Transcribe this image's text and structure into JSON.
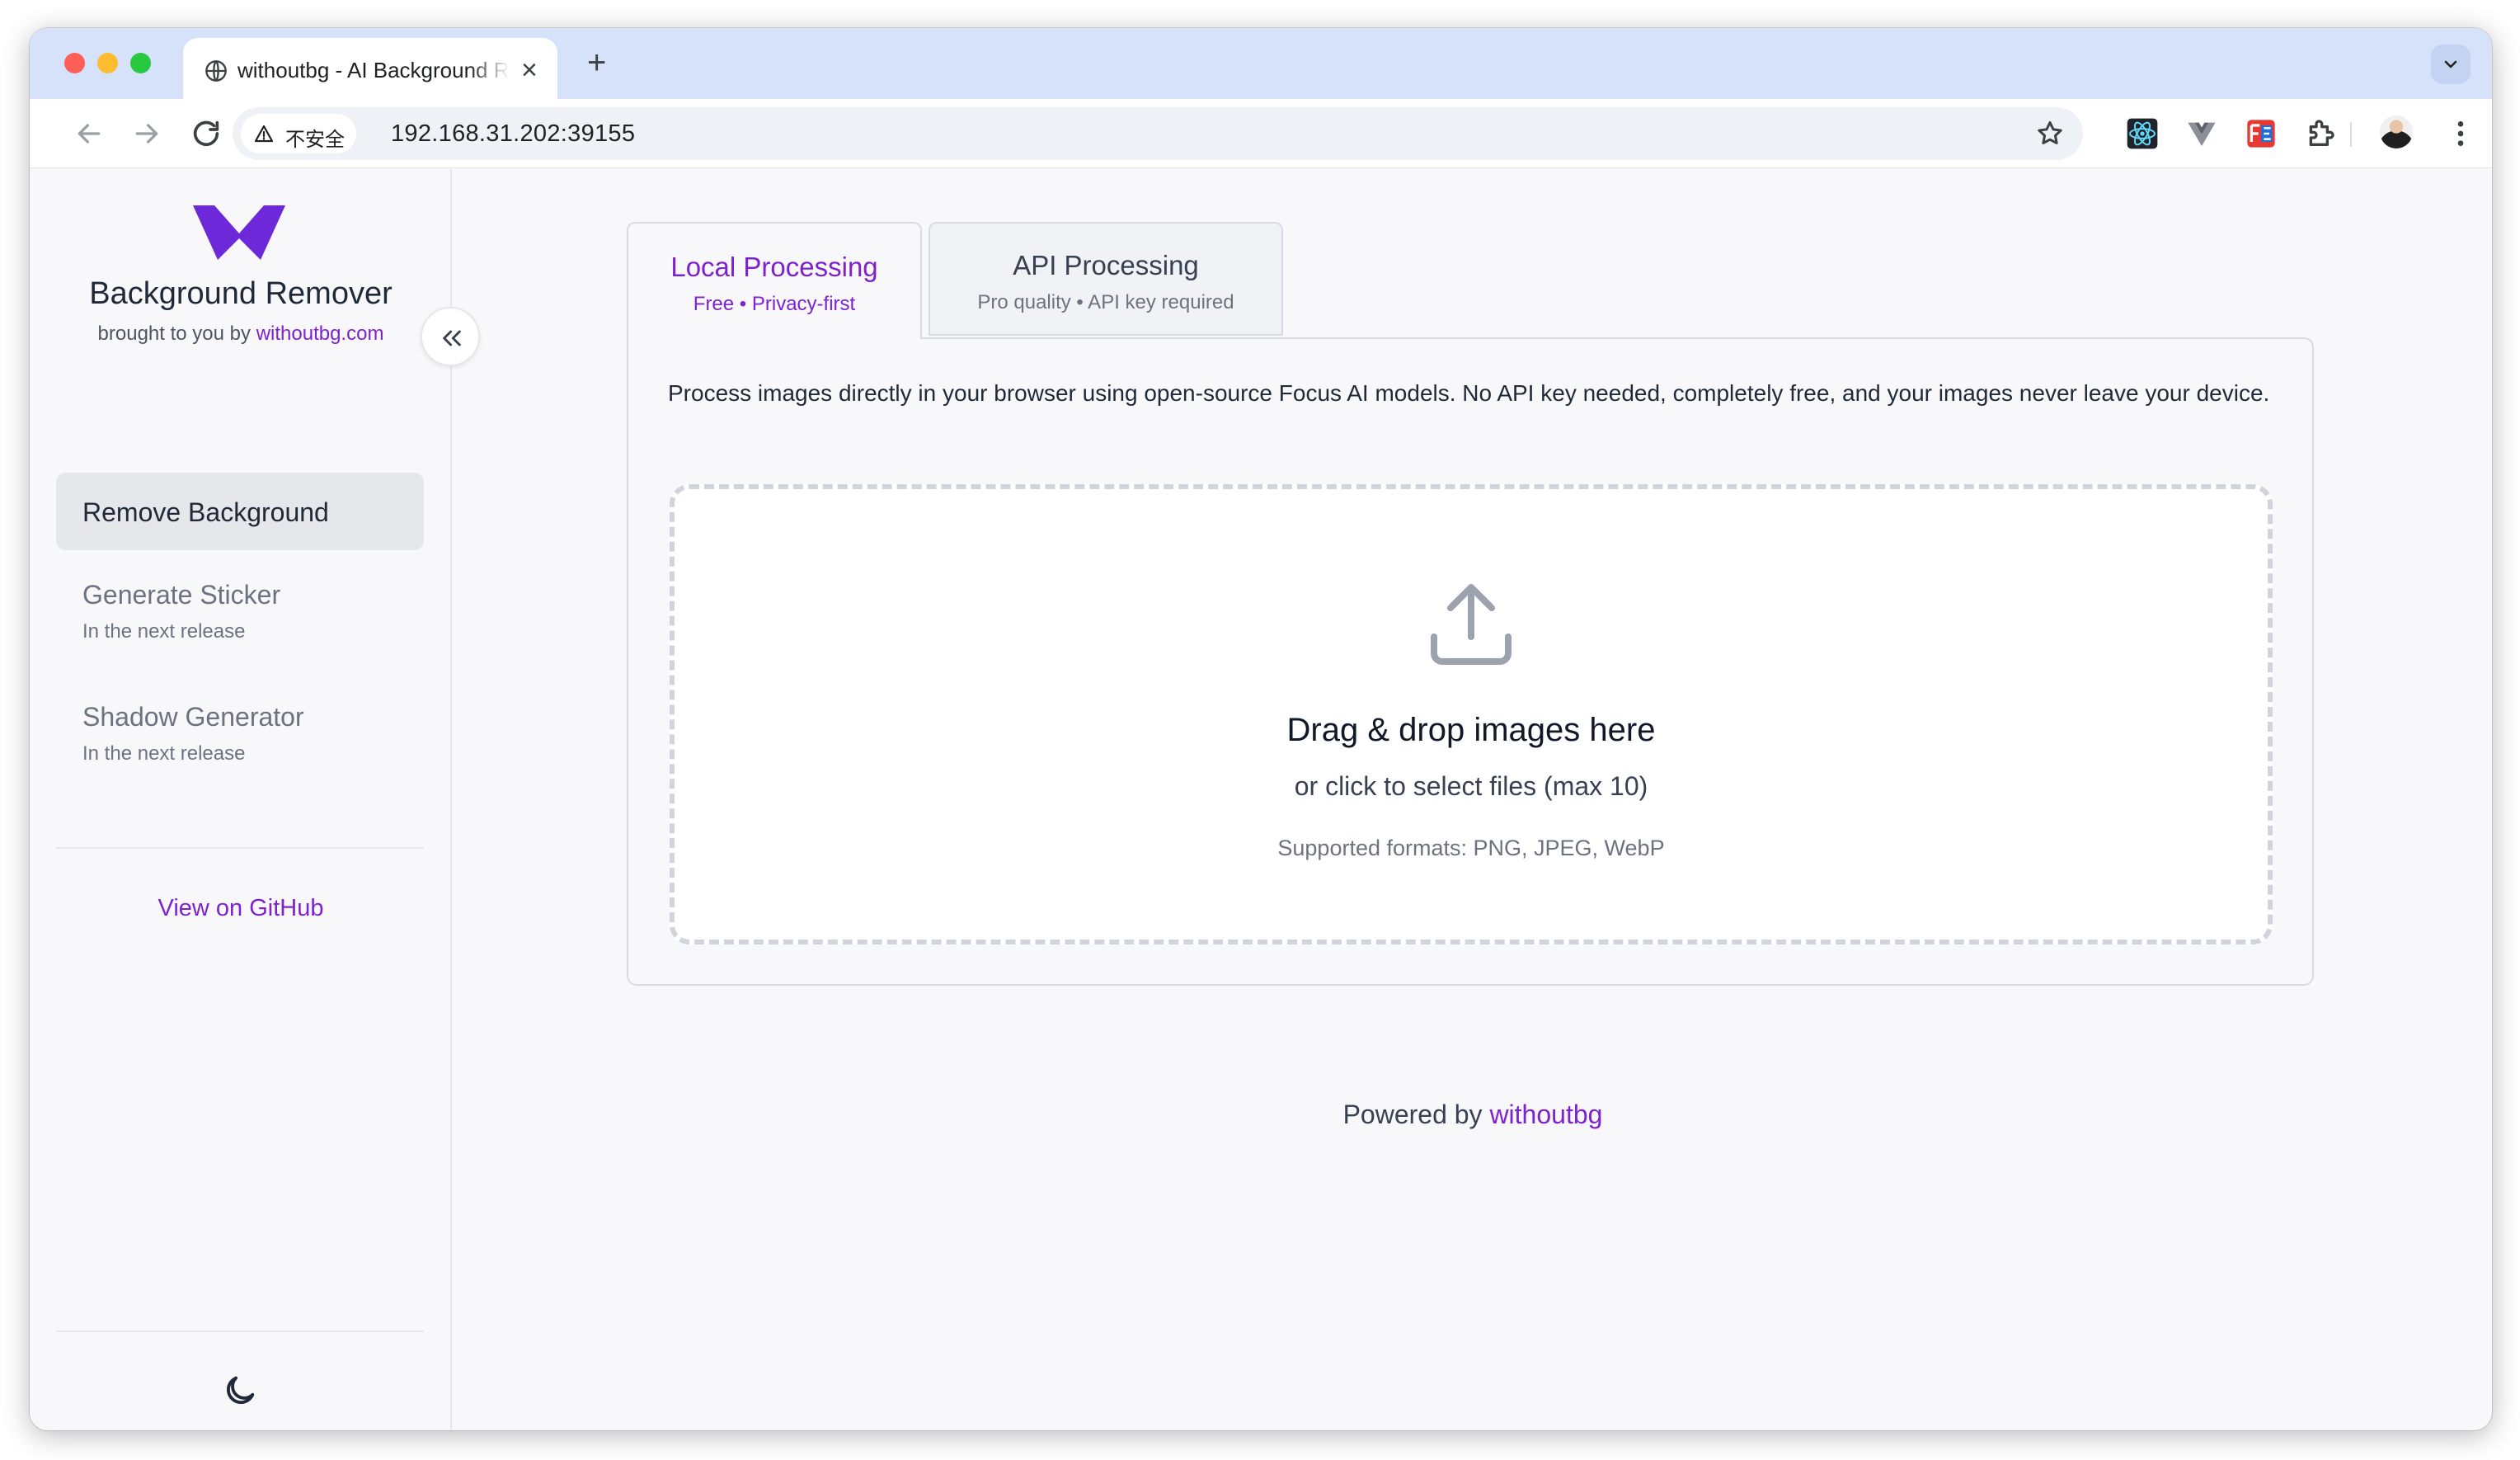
{
  "browser": {
    "tab_title": "withoutbg - AI Background Remover",
    "new_tab_label": "+",
    "security_label": "不安全",
    "url": "192.168.31.202:39155"
  },
  "sidebar": {
    "brand_title": "Background Remover",
    "brand_sub_prefix": "brought to you by",
    "brand_sub_link": "withoutbg.com",
    "items": [
      {
        "label": "Remove Background",
        "hint": ""
      },
      {
        "label": "Generate Sticker",
        "hint": "In the next release"
      },
      {
        "label": "Shadow Generator",
        "hint": "In the next release"
      }
    ],
    "github_link": "View on GitHub"
  },
  "main": {
    "tabs": [
      {
        "title": "Local Processing",
        "subtitle": "Free • Privacy-first"
      },
      {
        "title": "API Processing",
        "subtitle": "Pro quality • API key required"
      }
    ],
    "description": "Process images directly in your browser using open-source Focus AI models. No API key needed, completely free, and your images never leave your device.",
    "dropzone": {
      "title": "Drag & drop images here",
      "subtitle": "or click to select files (max 10)",
      "formats": "Supported formats: PNG, JPEG, WebP"
    },
    "footer_prefix": "Powered by",
    "footer_link": "withoutbg"
  },
  "colors": {
    "accent": "#7e22ce",
    "logo": "#6d28d9",
    "tabstrip": "#d5e2f9"
  }
}
